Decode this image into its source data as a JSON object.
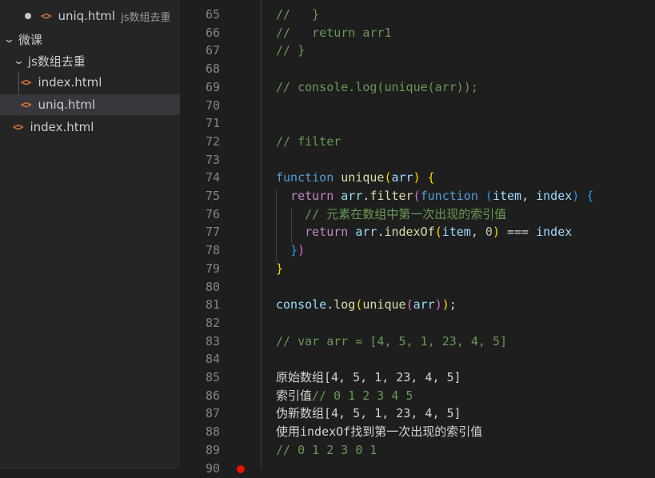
{
  "explorer": {
    "open_editor": {
      "label": "uniq.html",
      "description": "js数组去重"
    },
    "root_folder": "微课",
    "subfolder": "js数组去重",
    "subfolder_files": [
      "index.html",
      "uniq.html"
    ],
    "root_file": "index.html",
    "file_icon_glyph": "<>"
  },
  "editor": {
    "lines": [
      {
        "n": "65",
        "segs": [
          {
            "t": "//   }",
            "c": "cmt"
          }
        ]
      },
      {
        "n": "66",
        "segs": [
          {
            "t": "//   return arr1",
            "c": "cmt"
          }
        ]
      },
      {
        "n": "67",
        "segs": [
          {
            "t": "// }",
            "c": "cmt"
          }
        ]
      },
      {
        "n": "68",
        "segs": []
      },
      {
        "n": "69",
        "segs": [
          {
            "t": "// console.log(unique(arr));",
            "c": "cmt"
          }
        ]
      },
      {
        "n": "70",
        "segs": []
      },
      {
        "n": "71",
        "segs": []
      },
      {
        "n": "72",
        "segs": [
          {
            "t": "// filter",
            "c": "cmt"
          }
        ]
      },
      {
        "n": "73",
        "segs": []
      },
      {
        "n": "74",
        "segs": [
          {
            "t": "function",
            "c": "kw"
          },
          {
            "t": " ",
            "c": "plain"
          },
          {
            "t": "unique",
            "c": "fn"
          },
          {
            "t": "(",
            "c": "b1"
          },
          {
            "t": "arr",
            "c": "var"
          },
          {
            "t": ")",
            "c": "b1"
          },
          {
            "t": " ",
            "c": "plain"
          },
          {
            "t": "{",
            "c": "b1"
          }
        ]
      },
      {
        "n": "75",
        "segs": [
          {
            "t": "  ",
            "c": "plain"
          },
          {
            "t": "return",
            "c": "ctl"
          },
          {
            "t": " ",
            "c": "plain"
          },
          {
            "t": "arr",
            "c": "var"
          },
          {
            "t": ".",
            "c": "plain"
          },
          {
            "t": "filter",
            "c": "fn"
          },
          {
            "t": "(",
            "c": "b2"
          },
          {
            "t": "function",
            "c": "kw"
          },
          {
            "t": " ",
            "c": "plain"
          },
          {
            "t": "(",
            "c": "b3"
          },
          {
            "t": "item",
            "c": "var"
          },
          {
            "t": ", ",
            "c": "plain"
          },
          {
            "t": "index",
            "c": "var"
          },
          {
            "t": ")",
            "c": "b3"
          },
          {
            "t": " ",
            "c": "plain"
          },
          {
            "t": "{",
            "c": "b3"
          }
        ]
      },
      {
        "n": "76",
        "segs": [
          {
            "t": "    // 元素在数组中第一次出现的索引值",
            "c": "cmt"
          }
        ]
      },
      {
        "n": "77",
        "segs": [
          {
            "t": "    ",
            "c": "plain"
          },
          {
            "t": "return",
            "c": "ctl"
          },
          {
            "t": " ",
            "c": "plain"
          },
          {
            "t": "arr",
            "c": "var"
          },
          {
            "t": ".",
            "c": "plain"
          },
          {
            "t": "indexOf",
            "c": "fn"
          },
          {
            "t": "(",
            "c": "b1"
          },
          {
            "t": "item",
            "c": "var"
          },
          {
            "t": ", ",
            "c": "plain"
          },
          {
            "t": "0",
            "c": "num"
          },
          {
            "t": ")",
            "c": "b1"
          },
          {
            "t": " === ",
            "c": "op"
          },
          {
            "t": "index",
            "c": "var"
          }
        ]
      },
      {
        "n": "78",
        "segs": [
          {
            "t": "  ",
            "c": "plain"
          },
          {
            "t": "}",
            "c": "b3"
          },
          {
            "t": ")",
            "c": "b2"
          }
        ]
      },
      {
        "n": "79",
        "segs": [
          {
            "t": "}",
            "c": "b1"
          }
        ]
      },
      {
        "n": "80",
        "segs": []
      },
      {
        "n": "81",
        "segs": [
          {
            "t": "console",
            "c": "var"
          },
          {
            "t": ".",
            "c": "plain"
          },
          {
            "t": "log",
            "c": "fn"
          },
          {
            "t": "(",
            "c": "b1"
          },
          {
            "t": "unique",
            "c": "fn"
          },
          {
            "t": "(",
            "c": "b2"
          },
          {
            "t": "arr",
            "c": "var"
          },
          {
            "t": ")",
            "c": "b2"
          },
          {
            "t": ")",
            "c": "b1"
          },
          {
            "t": ";",
            "c": "plain"
          }
        ]
      },
      {
        "n": "82",
        "segs": []
      },
      {
        "n": "83",
        "segs": [
          {
            "t": "// var arr = [4, 5, 1, 23, 4, 5]",
            "c": "cmt"
          }
        ]
      },
      {
        "n": "84",
        "segs": []
      },
      {
        "n": "85",
        "segs": [
          {
            "t": "原始数组[4, 5, 1, 23, 4, 5]",
            "c": "plain"
          }
        ]
      },
      {
        "n": "86",
        "segs": [
          {
            "t": "索引值",
            "c": "plain"
          },
          {
            "t": "// 0 1 2 3 4 5",
            "c": "cmt"
          }
        ]
      },
      {
        "n": "87",
        "segs": [
          {
            "t": "伪新数组[4, 5, 1, 23, 4, 5]",
            "c": "plain"
          }
        ]
      },
      {
        "n": "88",
        "segs": [
          {
            "t": "使用indexOf找到第一次出现的索引值",
            "c": "plain"
          }
        ]
      },
      {
        "n": "89",
        "segs": [
          {
            "t": "// 0 1 2 3 0 1",
            "c": "cmt"
          }
        ]
      },
      {
        "n": "90",
        "segs": []
      }
    ]
  }
}
